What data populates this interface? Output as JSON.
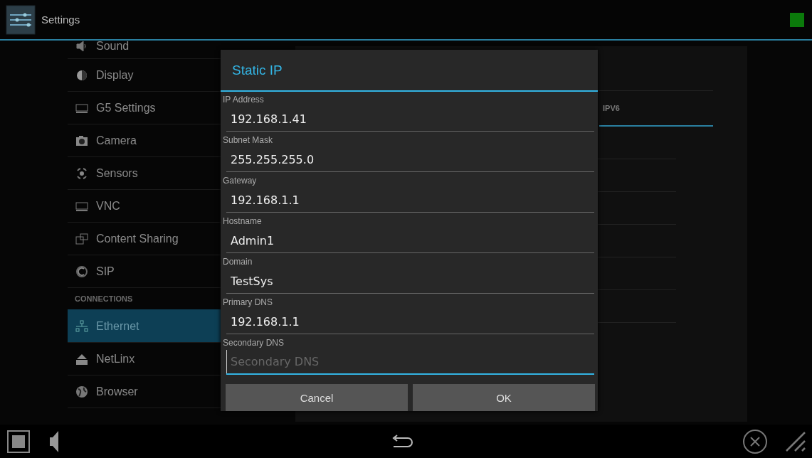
{
  "app_bar": {
    "title": "Settings"
  },
  "sidebar": {
    "items": [
      {
        "kind": "item",
        "label": "Sound",
        "selected": false
      },
      {
        "kind": "item",
        "label": "Display",
        "selected": false
      },
      {
        "kind": "item",
        "label": "G5 Settings",
        "selected": false
      },
      {
        "kind": "item",
        "label": "Camera",
        "selected": false
      },
      {
        "kind": "item",
        "label": "Sensors",
        "selected": false
      },
      {
        "kind": "item",
        "label": "VNC",
        "selected": false
      },
      {
        "kind": "item",
        "label": "Content Sharing",
        "selected": false
      },
      {
        "kind": "item",
        "label": "SIP",
        "selected": false
      },
      {
        "kind": "header",
        "label": "CONNECTIONS"
      },
      {
        "kind": "item",
        "label": "Ethernet",
        "selected": true
      },
      {
        "kind": "item",
        "label": "NetLinx",
        "selected": false
      },
      {
        "kind": "item",
        "label": "Browser",
        "selected": false
      }
    ]
  },
  "detail": {
    "tabs": [
      {
        "label": "IPV6",
        "selected": true
      }
    ]
  },
  "dialog": {
    "title": "Static IP",
    "fields": [
      {
        "label": "IP Address",
        "value": "192.168.1.41",
        "focused": false
      },
      {
        "label": "Subnet Mask",
        "value": "255.255.255.0",
        "focused": false
      },
      {
        "label": "Gateway",
        "value": "192.168.1.1",
        "focused": false
      },
      {
        "label": "Hostname",
        "value": "Admin1",
        "focused": false
      },
      {
        "label": "Domain",
        "value": "TestSys",
        "focused": false
      },
      {
        "label": "Primary DNS",
        "value": "192.168.1.1",
        "focused": false
      },
      {
        "label": "Secondary DNS",
        "placeholder": "Secondary DNS",
        "focused": true
      }
    ],
    "buttons": [
      "Cancel",
      "OK"
    ]
  }
}
